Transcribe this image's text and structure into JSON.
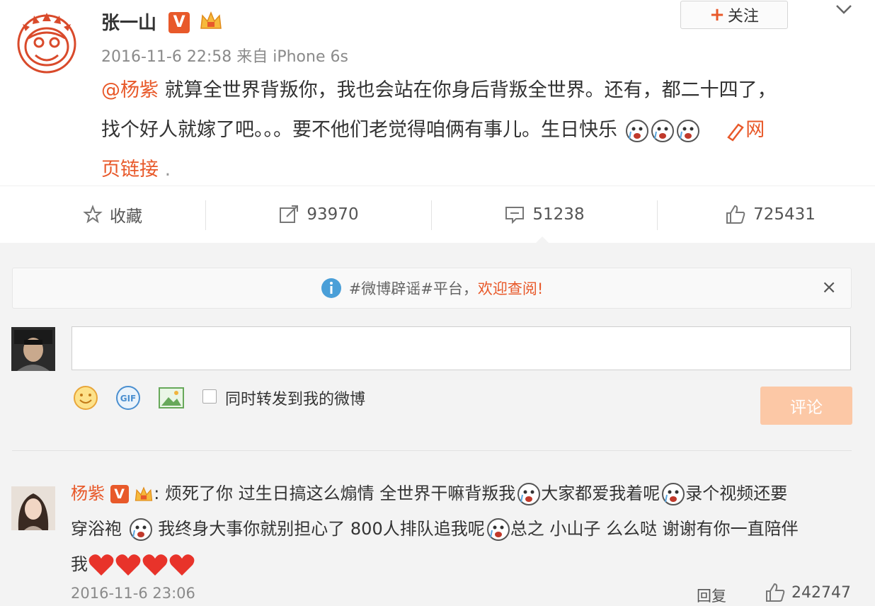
{
  "post": {
    "username": "张一山",
    "verified_badge": "V",
    "meta": "2016-11-6 22:58 来自 iPhone 6s",
    "follow_label": "关注",
    "mention": "@杨紫",
    "text_line1": " 就算全世界背叛你，我也会站在你身后背叛全世界。还有，都二十四了，",
    "text_line2": "找个好人就嫁了吧。。。要不他们老觉得咱俩有事儿。生日快乐",
    "link_label_part1": "网",
    "link_label_part2": "页链接",
    "link_trailing": " .",
    "icons": [
      "monkey-avatar",
      "verified-icon",
      "vip-crown-icon",
      "chevron-down-icon",
      "crying-emoji-icon",
      "link-pencil-icon"
    ]
  },
  "actions": {
    "favorite_label": "收藏",
    "repost_count": "93970",
    "comment_count": "51238",
    "like_count": "725431",
    "icons": [
      "star-icon",
      "repost-icon",
      "comment-icon",
      "thumbs-up-icon"
    ]
  },
  "notice": {
    "text_plain": "#微博辟谣#平台，",
    "text_highlight": "欢迎查阅!",
    "close": "×"
  },
  "composer": {
    "input_value": "",
    "repost_label": "同时转发到我的微博",
    "submit_label": "评论",
    "tools": [
      "smiley-icon",
      "gif-icon",
      "image-icon"
    ]
  },
  "comment": {
    "name": "杨紫",
    "badge": "V",
    "seg1": ": 烦死了你 过生日搞这么煽情 全世界干嘛背叛我",
    "seg2": "大家都爱我着呢",
    "seg3": "录个视频还要",
    "seg4": "穿浴袍 ",
    "seg5": "我终身大事你就别担心了 800人排队追我呢",
    "seg6": "总之 小山子 么么哒 谢谢有你一直陪伴",
    "seg7": "我",
    "date": "2016-11-6 23:06",
    "reply_label": "回复",
    "like_count": "242747"
  },
  "colors": {
    "accent": "#e8592a",
    "submit_disabled": "#fcc8a6",
    "info_blue": "#4a9fd8"
  }
}
